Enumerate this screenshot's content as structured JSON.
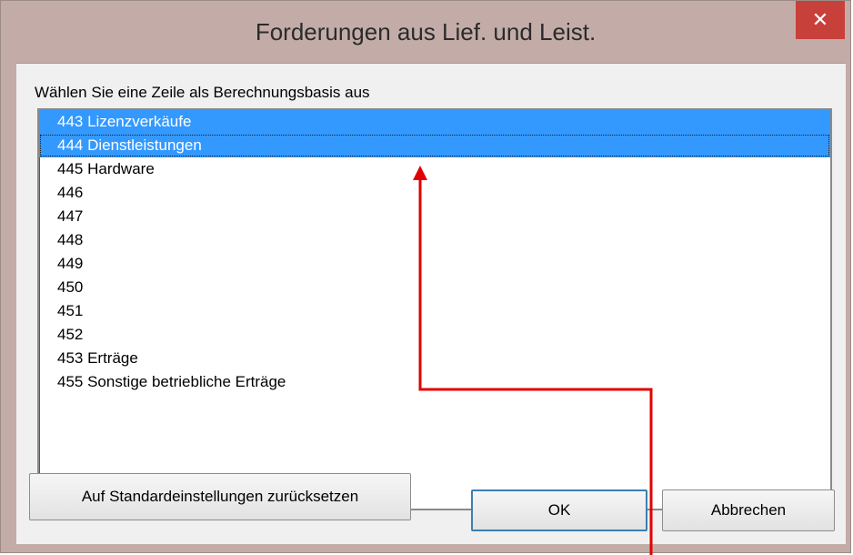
{
  "window": {
    "title": "Forderungen aus Lief. und Leist.",
    "close_glyph": "✕"
  },
  "prompt": "Wählen Sie eine Zeile als Berechnungsbasis aus",
  "list": {
    "items": [
      {
        "label": "443 Lizenzverkäufe",
        "selected": true
      },
      {
        "label": "444 Dienstleistungen",
        "selected": true,
        "focused": true
      },
      {
        "label": "445 Hardware"
      },
      {
        "label": "446"
      },
      {
        "label": "447"
      },
      {
        "label": "448"
      },
      {
        "label": "449"
      },
      {
        "label": "450"
      },
      {
        "label": "451"
      },
      {
        "label": "452"
      },
      {
        "label": "453 Erträge"
      },
      {
        "label": "455 Sonstige betriebliche Erträge"
      }
    ]
  },
  "buttons": {
    "reset": "Auf Standardeinstellungen zurücksetzen",
    "ok": "OK",
    "cancel": "Abbrechen"
  },
  "colors": {
    "selection": "#3399ff",
    "annotation_arrow": "#e00000",
    "close_button": "#c8403a"
  }
}
